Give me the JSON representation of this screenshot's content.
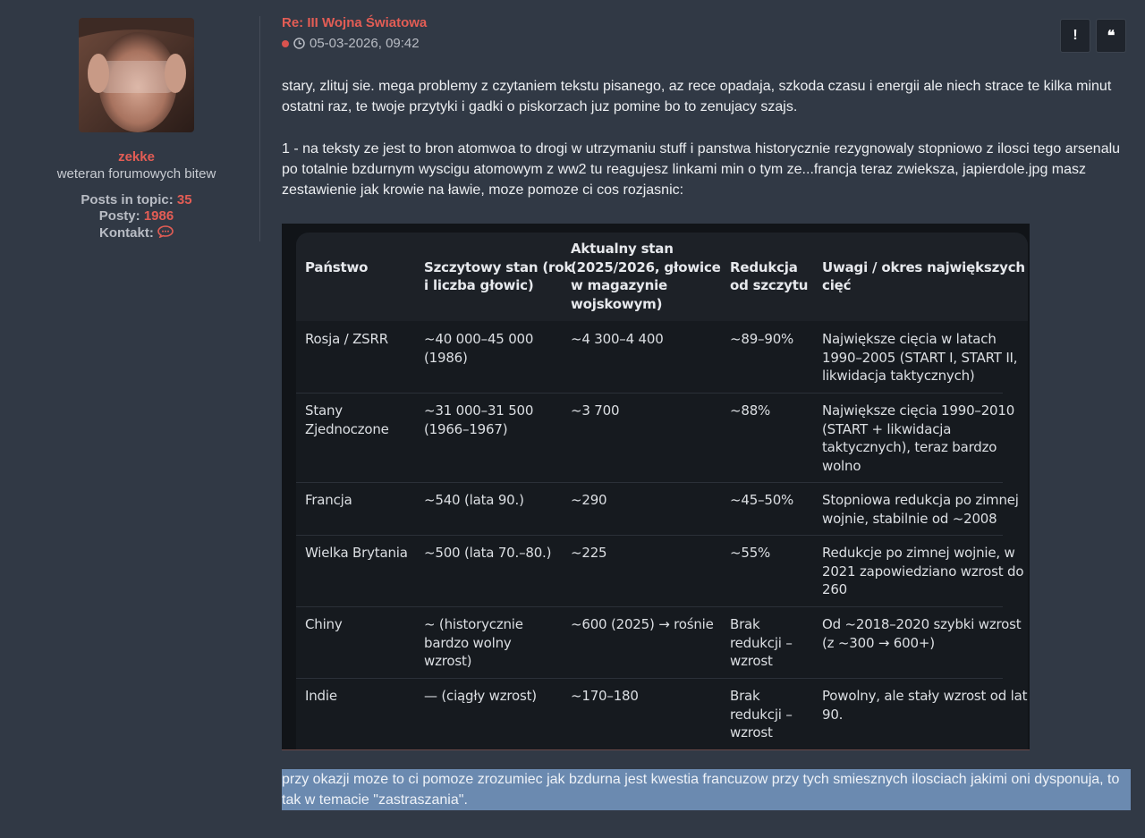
{
  "profile": {
    "username": "zekke",
    "rank": "weteran forumowych bitew",
    "posts_in_topic_label": "Posts in topic:",
    "posts_in_topic_value": "35",
    "posts_label": "Posty:",
    "posts_value": "1986",
    "contact_label": "Kontakt:"
  },
  "post": {
    "title": "Re: III Wojna Światowa",
    "datetime": "05-03-2026, 09:42",
    "report_icon": "!",
    "quote_icon": "❝",
    "paragraph1": "stary, zlituj sie. mega problemy z czytaniem tekstu pisanego, az rece opadaja, szkoda czasu i energii ale niech strace te kilka minut ostatni raz, te twoje przytyki i gadki o piskorzach juz pomine bo to zenujacy szajs.",
    "paragraph2": "1 - na teksty ze jest to bron atomwoa to drogi w utrzymaniu stuff i panstwa historycznie rezygnowaly stopniowo z ilosci tego arsenalu po totalnie bzdurnym wyscigu atomowym z ww2 tu reagujesz linkami min o tym ze...francja teraz zwieksza, japierdole.jpg masz zestawienie jak krowie na ławie, moze pomoze ci cos rozjasnic:",
    "paragraph3": "przy okazji moze to ci pomoze zrozumiec jak bzdurna jest kwestia francuzow przy tych smiesznych ilosciach jakimi oni dysponuja, to tak w temacie \"zastraszania\"."
  },
  "table": {
    "headers": [
      "Państwo",
      "Szczytowy stan (rok\ni liczba głowic)",
      "Aktualny stan\n(2025/2026, głowice\nw magazynie\nwojskowym)",
      "Redukcja\nod szczytu",
      "Uwagi / okres największych\ncięć"
    ],
    "rows": [
      [
        "Rosja / ZSRR",
        "~40 000–45 000\n(1986)",
        "~4 300–4 400",
        "~89–90%",
        "Największe cięcia w latach\n1990–2005 (START I, START II,\nlikwidacja taktycznych)"
      ],
      [
        "Stany\nZjednoczone",
        "~31 000–31 500\n(1966–1967)",
        "~3 700",
        "~88%",
        "Największe cięcia 1990–2010\n(START + likwidacja\ntaktycznych), teraz bardzo\nwolno"
      ],
      [
        "Francja",
        "~540 (lata 90.)",
        "~290",
        "~45–50%",
        "Stopniowa redukcja po zimnej\nwojnie, stabilnie od ~2008"
      ],
      [
        "Wielka Brytania",
        "~500 (lata 70.–80.)",
        "~225",
        "~55%",
        "Redukcje po zimnej wojnie, w\n2021 zapowiedziano wzrost do\n260"
      ],
      [
        "Chiny",
        "~ (historycznie\nbardzo wolny\nwzrost)",
        "~600 (2025) → rośnie",
        "Brak\nredukcji –\nwzrost",
        "Od ~2018–2020 szybki wzrost\n(z ~300 → 600+)"
      ],
      [
        "Indie",
        "— (ciągły wzrost)",
        "~170–180",
        "Brak\nredukcji –\nwzrost",
        "Powolny, ale stały wzrost od lat\n90."
      ]
    ]
  },
  "colors": {
    "background": "#313945",
    "accent": "#e35d55",
    "selection": "#6b8ab0"
  },
  "icons": [
    "clock-icon",
    "chat-bubble-icon",
    "report-icon",
    "quote-icon"
  ]
}
